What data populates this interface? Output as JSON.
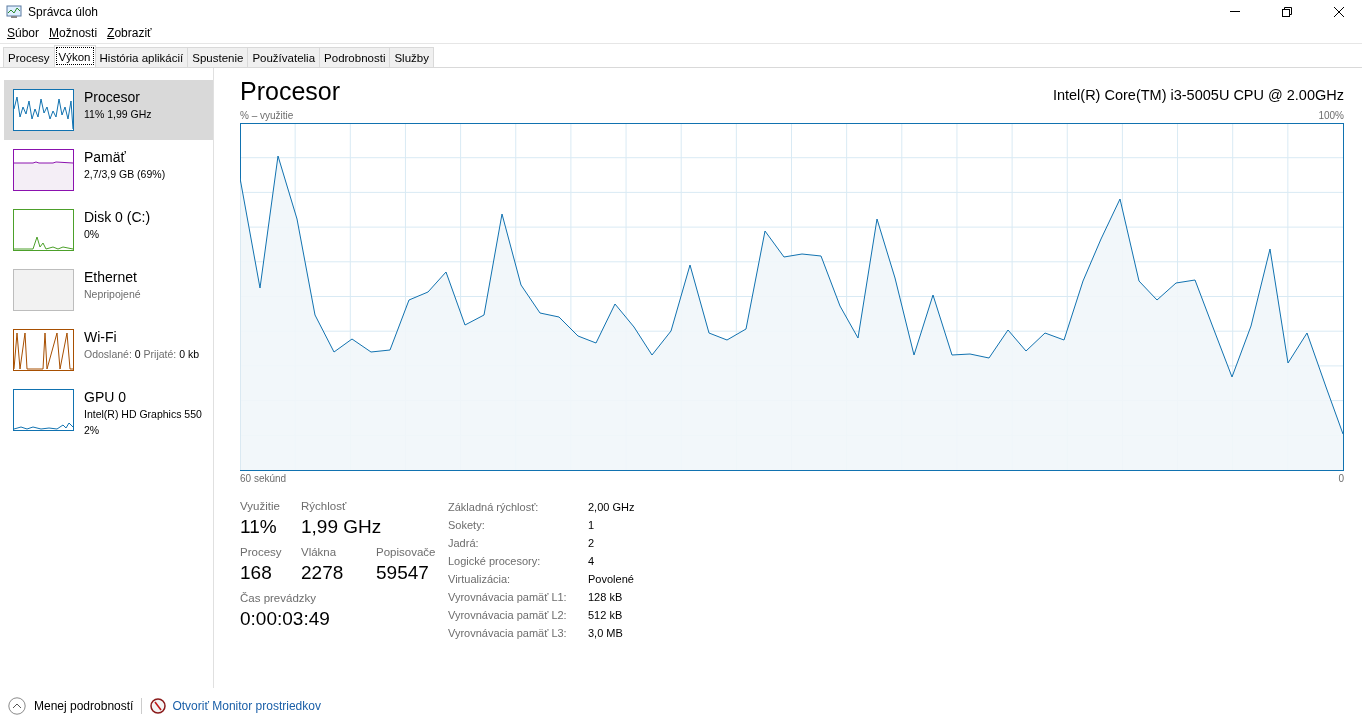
{
  "window": {
    "title": "Správca úloh"
  },
  "menu": [
    {
      "label": "Súbor"
    },
    {
      "label": "Možnosti"
    },
    {
      "label": "Zobraziť"
    }
  ],
  "tabs": [
    {
      "label": "Procesy",
      "selected": false
    },
    {
      "label": "Výkon",
      "selected": true
    },
    {
      "label": "História aplikácií",
      "selected": false
    },
    {
      "label": "Spustenie",
      "selected": false
    },
    {
      "label": "Používatelia",
      "selected": false
    },
    {
      "label": "Podrobnosti",
      "selected": false
    },
    {
      "label": "Služby",
      "selected": false
    }
  ],
  "sidebar": {
    "items": [
      {
        "kind": "cpu",
        "name": "Procesor",
        "lines": [
          "11% 1,99 GHz"
        ],
        "selected": true,
        "color": "#1172b0"
      },
      {
        "kind": "memory",
        "name": "Pamäť",
        "lines": [
          "2,7/3,9 GB (69%)"
        ],
        "selected": false,
        "color": "#8b12ae"
      },
      {
        "kind": "disk",
        "name": "Disk 0 (C:)",
        "lines": [
          "0%"
        ],
        "selected": false,
        "color": "#4ca02a"
      },
      {
        "kind": "ethernet",
        "name": "Ethernet",
        "lines": [
          "Nepripojené"
        ],
        "selected": false,
        "color": "#bdbdbd"
      },
      {
        "kind": "wifi",
        "name": "Wi-Fi",
        "lines": [
          "**Odoslané:** 0 **Prijaté:** 0 kb"
        ],
        "selected": false,
        "color": "#a74f01"
      },
      {
        "kind": "gpu",
        "name": "GPU 0",
        "lines": [
          "Intel(R) HD Graphics 550",
          "2%"
        ],
        "selected": false,
        "color": "#1172b0"
      }
    ]
  },
  "main": {
    "title": "Procesor",
    "device": "Intel(R) Core(TM) i3-5005U CPU @ 2.00GHz",
    "graph": {
      "ylabel": "% – využitie",
      "ymax": "100%",
      "xstart": "60 sekúnd",
      "xend": "0"
    },
    "stats": [
      [
        {
          "label": "Využitie",
          "value": "11%"
        },
        {
          "label": "Rýchlosť",
          "value": "1,99 GHz"
        }
      ],
      [
        {
          "label": "Procesy",
          "value": "168"
        },
        {
          "label": "Vlákna",
          "value": "2278"
        },
        {
          "label": "Popisovače",
          "value": "59547"
        }
      ],
      [
        {
          "label": "Čas prevádzky",
          "value": "0:00:03:49"
        }
      ]
    ],
    "details": [
      {
        "label": "Základná rýchlosť:",
        "value": "2,00 GHz"
      },
      {
        "label": "Sokety:",
        "value": "1"
      },
      {
        "label": "Jadrá:",
        "value": "2"
      },
      {
        "label": "Logické procesory:",
        "value": "4"
      },
      {
        "label": "Virtualizácia:",
        "value": "Povolené"
      },
      {
        "label": "Vyrovnávacia pamäť L1:",
        "value": "128 kB"
      },
      {
        "label": "Vyrovnávacia pamäť L2:",
        "value": "512 kB"
      },
      {
        "label": "Vyrovnávacia pamäť L3:",
        "value": "3,0 MB"
      }
    ]
  },
  "footer": {
    "less": "Menej podrobností",
    "monitor": "Otvoriť Monitor prostriedkov"
  }
}
